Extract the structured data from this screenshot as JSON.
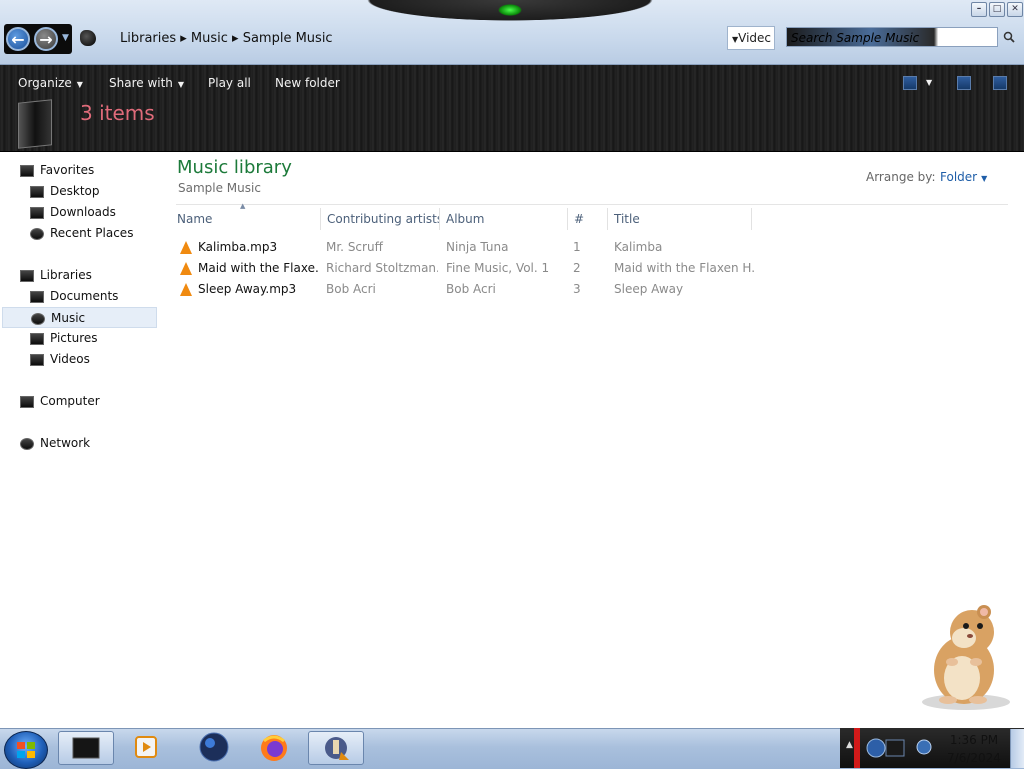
{
  "window": {
    "address_path": "Libraries ▸ Music ▸ Sample Music",
    "view_combo_text": "Videc",
    "search_placeholder": "Search Sample Music",
    "minimize_symbol": "–",
    "maximize_symbol": "□",
    "close_symbol": "✕"
  },
  "toolbar": {
    "organize": "Organize",
    "share_with": "Share with",
    "play_all": "Play all",
    "new_folder": "New folder"
  },
  "details": {
    "item_count": "3 items"
  },
  "nav": {
    "favorites": "Favorites",
    "desktop": "Desktop",
    "downloads": "Downloads",
    "recent_places": "Recent Places",
    "libraries": "Libraries",
    "documents": "Documents",
    "music": "Music",
    "pictures": "Pictures",
    "videos": "Videos",
    "computer": "Computer",
    "network": "Network"
  },
  "content": {
    "title": "Music library",
    "subtitle": "Sample Music",
    "arrange_label": "Arrange by:",
    "arrange_value": "Folder",
    "columns": [
      "Name",
      "Contributing artists",
      "Album",
      "#",
      "Title"
    ],
    "rows": [
      {
        "name": "Kalimba.mp3",
        "artist": "Mr. Scruff",
        "album": "Ninja Tuna",
        "track": "1",
        "title": "Kalimba"
      },
      {
        "name": "Maid with the Flaxe...",
        "artist": "Richard Stoltzman...",
        "album": "Fine Music, Vol. 1",
        "track": "2",
        "title": "Maid with the Flaxen H..."
      },
      {
        "name": "Sleep Away.mp3",
        "artist": "Bob Acri",
        "album": "Bob Acri",
        "track": "3",
        "title": "Sleep Away"
      }
    ]
  },
  "taskbar": {
    "clock_time": "1:36 PM",
    "clock_date": "7/6/2024"
  },
  "colors": {
    "library_title": "#1c7a3a",
    "item_count": "#e06b7a",
    "link": "#1f5ea8",
    "file_icon": "#f08a10"
  }
}
